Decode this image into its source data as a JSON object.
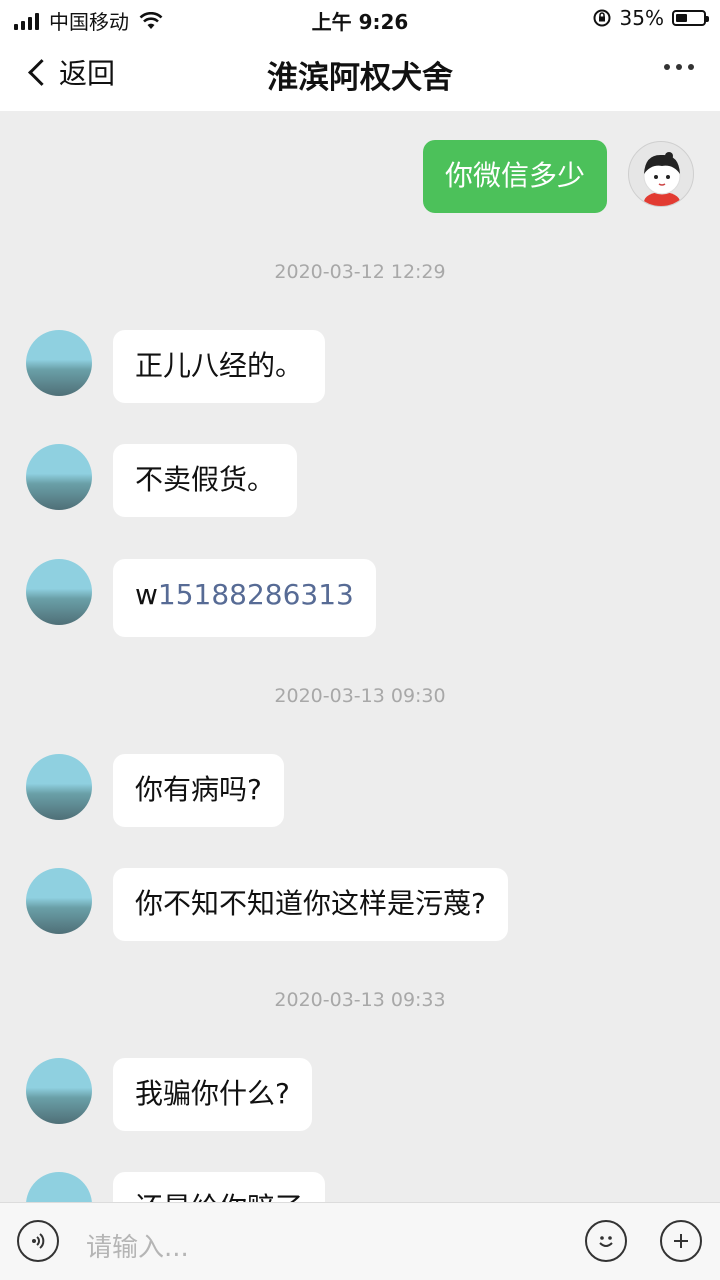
{
  "status_bar": {
    "carrier": "中国移动",
    "time": "上午 9:26",
    "battery": "35%",
    "icons": [
      "signal-icon",
      "wifi-icon",
      "rotation-lock-icon",
      "battery-icon"
    ]
  },
  "nav": {
    "back_label": "返回",
    "title": "淮滨阿权犬舍",
    "more_icon": "more-dots-icon"
  },
  "messages": {
    "m1": "你微信多少",
    "ts1": "2020-03-12 12:29",
    "m2": "正儿八经的。",
    "m3": "不卖假货。",
    "m4_prefix": "w",
    "m4_link": "15188286313",
    "ts2": "2020-03-13 09:30",
    "m5": "你有病吗?",
    "m6": "你不知不知道你这样是污蔑?",
    "ts3": "2020-03-13 09:33",
    "m7": "我骗你什么?",
    "m8": "还是给你赔了"
  },
  "input": {
    "placeholder": "请输入...",
    "icons": [
      "voice-icon",
      "emoji-icon",
      "plus-icon"
    ]
  },
  "colors": {
    "self_bubble": "#4cc15a",
    "link": "#576b95",
    "background": "#ededed"
  }
}
